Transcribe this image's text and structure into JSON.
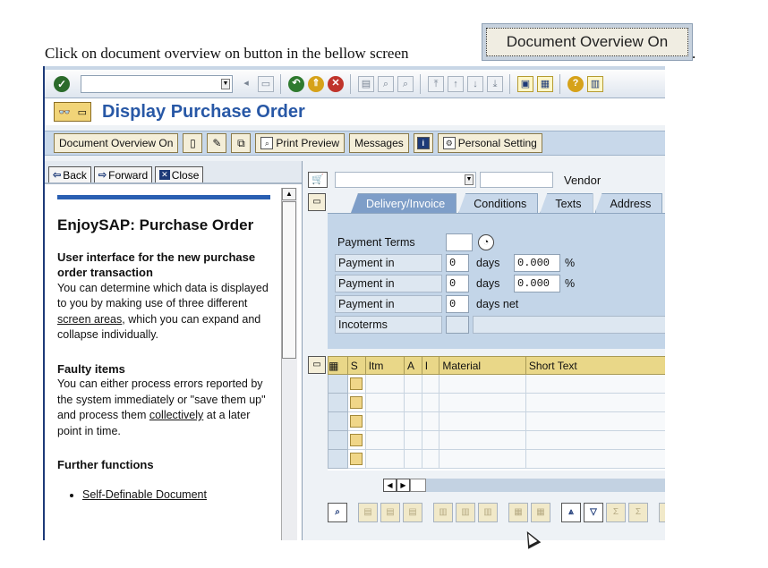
{
  "caption": {
    "text": "Click on document overview on button in the bellow screen",
    "period": "."
  },
  "callout_button": {
    "label": "Document Overview On"
  },
  "window": {
    "title": "Display Purchase Order",
    "accent_color": "#2858a6"
  },
  "system_toolbar": {
    "command_field_value": "",
    "icons": [
      "enter-icon",
      "back-icon",
      "exit-icon",
      "cancel-icon",
      "print-icon",
      "find-icon",
      "find-next-icon",
      "first-page-icon",
      "previous-page-icon",
      "next-page-icon",
      "last-page-icon",
      "create-session-icon",
      "shortcut-icon",
      "help-icon",
      "layout-menu-icon"
    ]
  },
  "app_toolbar": {
    "document_overview_label": "Document Overview On",
    "print_preview_label": "Print Preview",
    "messages_label": "Messages",
    "personal_setting_label": "Personal Setting"
  },
  "help_nav": {
    "back_label": "Back",
    "forward_label": "Forward",
    "close_label": "Close"
  },
  "help": {
    "heading": "EnjoySAP: Purchase Order",
    "section1_title": "User interface for the new purchase order transaction",
    "section1_pre": "You can determine which data is displayed to you by making use of three different ",
    "section1_link": "screen areas",
    "section1_post": ", which you can expand and collapse individually.",
    "section2_title": "Faulty items",
    "section2_pre": "You can either process errors reported by the system immediately or \"save them up\" and process them ",
    "section2_link": "collectively",
    "section2_post": " at a later point in time.",
    "section3_title": "Further functions",
    "list_item1": "Self-Definable Document"
  },
  "header": {
    "vendor_label": "Vendor"
  },
  "tabs": [
    {
      "label": "Delivery/Invoice",
      "active": true
    },
    {
      "label": "Conditions",
      "active": false
    },
    {
      "label": "Texts",
      "active": false
    },
    {
      "label": "Address",
      "active": false
    }
  ],
  "payment": {
    "terms_label": "Payment Terms",
    "rows": [
      {
        "label": "Payment in",
        "days": "0",
        "unit": "days",
        "pct": "0.000",
        "pct_symbol": "%"
      },
      {
        "label": "Payment in",
        "days": "0",
        "unit": "days",
        "pct": "0.000",
        "pct_symbol": "%"
      },
      {
        "label": "Payment in",
        "days": "0",
        "unit": "days net"
      }
    ],
    "incoterms_label": "Incoterms"
  },
  "items_grid": {
    "columns": [
      "S",
      "Itm",
      "A",
      "I",
      "Material",
      "Short Text"
    ],
    "empty_rows": 5
  }
}
